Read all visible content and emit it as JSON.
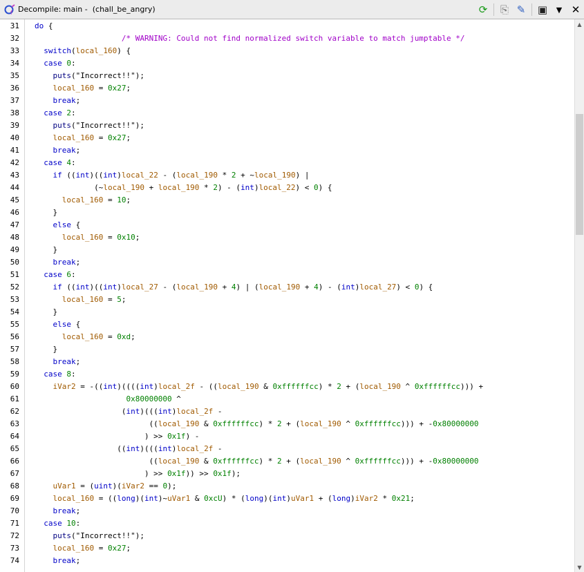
{
  "window": {
    "title": "Decompile: main -  (chall_be_angry)"
  },
  "toolbar": {
    "buttons": [
      {
        "name": "refresh-icon",
        "glyph": "⟳",
        "color": "#1a9a1a"
      },
      {
        "name": "copy-icon",
        "glyph": "⎘",
        "color": "#7a7a7a"
      },
      {
        "name": "edit-icon",
        "glyph": "✎",
        "color": "#3060c0"
      },
      {
        "name": "snapshot-icon",
        "glyph": "▣",
        "color": "#202020"
      },
      {
        "name": "menu-dropdown-icon",
        "glyph": "▼",
        "color": "#000000"
      },
      {
        "name": "close-icon",
        "glyph": "✕",
        "color": "#000000"
      }
    ]
  },
  "code": {
    "lines": [
      {
        "n": "31",
        "t": "do {"
      },
      {
        "n": "32",
        "t": "                   /* WARNING: Could not find normalized switch variable to match jumptable */"
      },
      {
        "n": "33",
        "t": "  switch(local_160) {"
      },
      {
        "n": "34",
        "t": "  case 0:"
      },
      {
        "n": "35",
        "t": "    puts(\"Incorrect!!\");"
      },
      {
        "n": "36",
        "t": "    local_160 = 0x27;"
      },
      {
        "n": "37",
        "t": "    break;"
      },
      {
        "n": "38",
        "t": "  case 2:"
      },
      {
        "n": "39",
        "t": "    puts(\"Incorrect!!\");"
      },
      {
        "n": "40",
        "t": "    local_160 = 0x27;"
      },
      {
        "n": "41",
        "t": "    break;"
      },
      {
        "n": "42",
        "t": "  case 4:"
      },
      {
        "n": "43",
        "t": "    if ((int)((int)local_22 - (local_190 * 2 + ~local_190) |"
      },
      {
        "n": "44",
        "t": "             (~local_190 + local_190 * 2) - (int)local_22) < 0) {"
      },
      {
        "n": "45",
        "t": "      local_160 = 10;"
      },
      {
        "n": "46",
        "t": "    }"
      },
      {
        "n": "47",
        "t": "    else {"
      },
      {
        "n": "48",
        "t": "      local_160 = 0x10;"
      },
      {
        "n": "49",
        "t": "    }"
      },
      {
        "n": "50",
        "t": "    break;"
      },
      {
        "n": "51",
        "t": "  case 6:"
      },
      {
        "n": "52",
        "t": "    if ((int)((int)local_27 - (local_190 + 4) | (local_190 + 4) - (int)local_27) < 0) {"
      },
      {
        "n": "53",
        "t": "      local_160 = 5;"
      },
      {
        "n": "54",
        "t": "    }"
      },
      {
        "n": "55",
        "t": "    else {"
      },
      {
        "n": "56",
        "t": "      local_160 = 0xd;"
      },
      {
        "n": "57",
        "t": "    }"
      },
      {
        "n": "58",
        "t": "    break;"
      },
      {
        "n": "59",
        "t": "  case 8:"
      },
      {
        "n": "60",
        "t": "    iVar2 = -((int)((((int)local_2f - ((local_190 & 0xffffffcc) * 2 + (local_190 ^ 0xffffffcc))) +"
      },
      {
        "n": "61",
        "t": "                    0x80000000 ^"
      },
      {
        "n": "62",
        "t": "                   (int)(((int)local_2f -"
      },
      {
        "n": "63",
        "t": "                         ((local_190 & 0xffffffcc) * 2 + (local_190 ^ 0xffffffcc))) + -0x80000000"
      },
      {
        "n": "64",
        "t": "                        ) >> 0x1f) -"
      },
      {
        "n": "65",
        "t": "                  ((int)(((int)local_2f -"
      },
      {
        "n": "66",
        "t": "                         ((local_190 & 0xffffffcc) * 2 + (local_190 ^ 0xffffffcc))) + -0x80000000"
      },
      {
        "n": "67",
        "t": "                        ) >> 0x1f)) >> 0x1f);"
      },
      {
        "n": "68",
        "t": "    uVar1 = (uint)(iVar2 == 0);"
      },
      {
        "n": "69",
        "t": "    local_160 = ((long)(int)~uVar1 & 0xcU) * (long)(int)uVar1 + (long)iVar2 * 0x21;"
      },
      {
        "n": "70",
        "t": "    break;"
      },
      {
        "n": "71",
        "t": "  case 10:"
      },
      {
        "n": "72",
        "t": "    puts(\"Incorrect!!\");"
      },
      {
        "n": "73",
        "t": "    local_160 = 0x27;"
      },
      {
        "n": "74",
        "t": "    break;"
      }
    ]
  }
}
